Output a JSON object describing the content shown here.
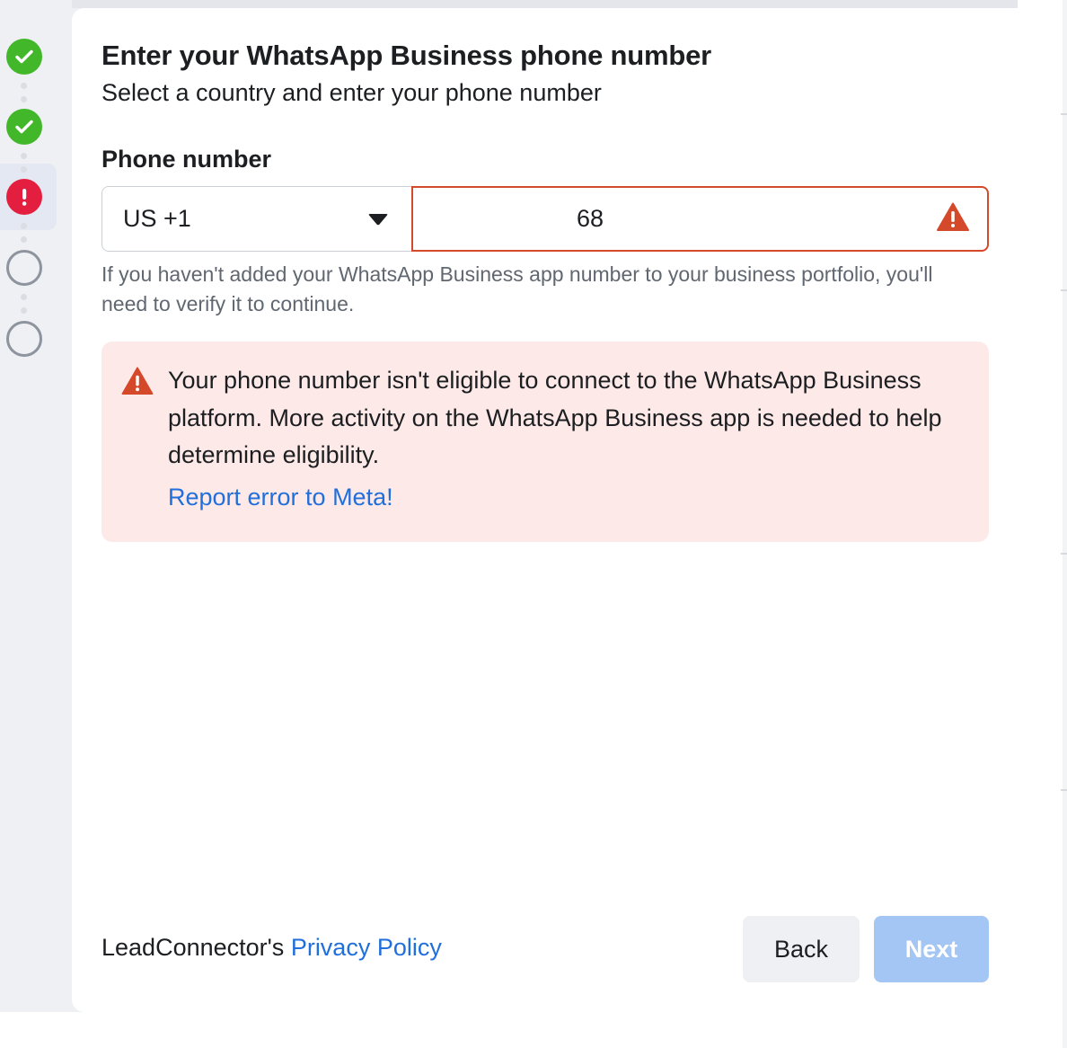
{
  "header": {
    "title": "Enter your WhatsApp Business phone number",
    "subtitle": "Select a country and enter your phone number"
  },
  "stepper": {
    "steps": [
      {
        "status": "complete",
        "icon": "check-icon"
      },
      {
        "status": "complete",
        "icon": "check-icon"
      },
      {
        "status": "error",
        "icon": "exclamation-icon"
      },
      {
        "status": "pending",
        "icon": "empty-circle-icon"
      },
      {
        "status": "pending",
        "icon": "empty-circle-icon"
      }
    ]
  },
  "phone": {
    "label": "Phone number",
    "country_code": "US +1",
    "value": "68",
    "helper": "If you haven't added your WhatsApp Business app number to your business portfolio, you'll need to verify it to continue."
  },
  "alert": {
    "message": "Your phone number isn't eligible to connect to the WhatsApp Business platform. More activity on the WhatsApp Business app is needed to help determine eligibility.",
    "link": "Report error to Meta!"
  },
  "footer": {
    "prefix": "LeadConnector's",
    "link": "Privacy Policy",
    "back_label": "Back",
    "next_label": "Next"
  },
  "colors": {
    "success": "#42b72a",
    "error": "#e41e3f",
    "warning": "#d5492b",
    "link": "#216fdb",
    "alert_background": "#fdeae8",
    "next_disabled": "#a4c6f5"
  }
}
